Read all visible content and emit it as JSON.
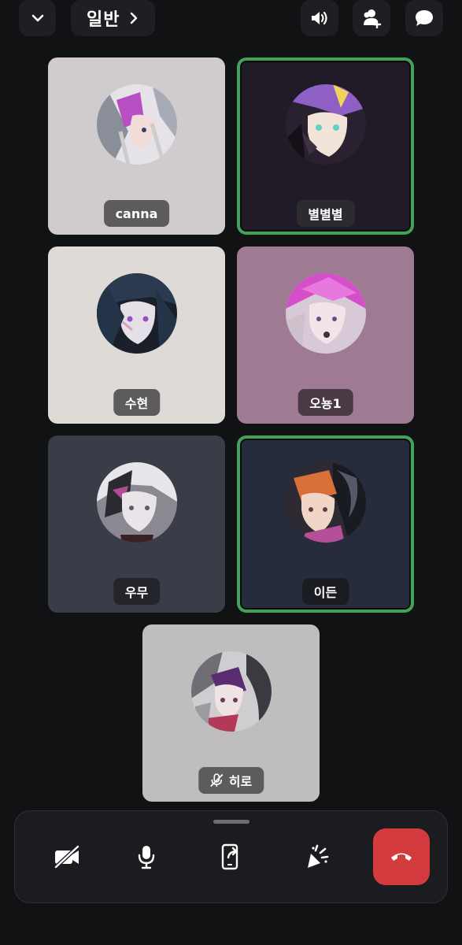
{
  "header": {
    "channel_name": "일반",
    "icons": [
      "chevron-down-icon",
      "chevron-right-icon",
      "speaker-icon",
      "add-user-icon",
      "chat-icon"
    ]
  },
  "participants": [
    {
      "name": "canna",
      "speaking": false,
      "muted": false
    },
    {
      "name": "별별별",
      "speaking": true,
      "muted": false
    },
    {
      "name": "수현",
      "speaking": false,
      "muted": false
    },
    {
      "name": "오뇽1",
      "speaking": false,
      "muted": false
    },
    {
      "name": "우무",
      "speaking": false,
      "muted": false
    },
    {
      "name": "이든",
      "speaking": true,
      "muted": false
    },
    {
      "name": "히로",
      "speaking": false,
      "muted": true
    }
  ],
  "controls": {
    "icons": [
      "camera-off-icon",
      "microphone-icon",
      "screen-share-icon",
      "effects-icon",
      "hang-up-icon"
    ],
    "leave_color": "#d33b3f"
  },
  "colors": {
    "background": "#111214",
    "speaking_border": "#43a25a"
  }
}
